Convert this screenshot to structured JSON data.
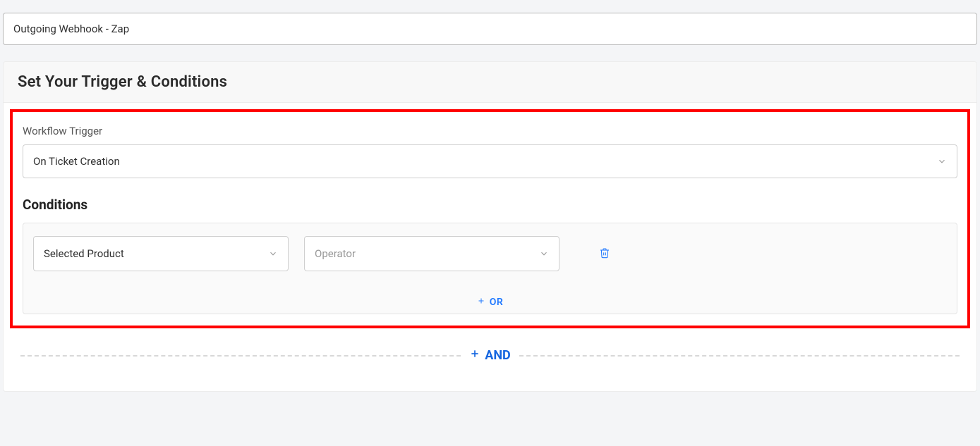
{
  "name_input": {
    "value": "Outgoing Webhook - Zap"
  },
  "panel": {
    "heading": "Set Your Trigger & Conditions",
    "trigger_label": "Workflow Trigger",
    "trigger_value": "On Ticket Creation",
    "conditions_heading": "Conditions",
    "condition1": {
      "field_value": "Selected Product",
      "operator_placeholder": "Operator"
    },
    "or_label": "OR",
    "and_label": "AND"
  }
}
